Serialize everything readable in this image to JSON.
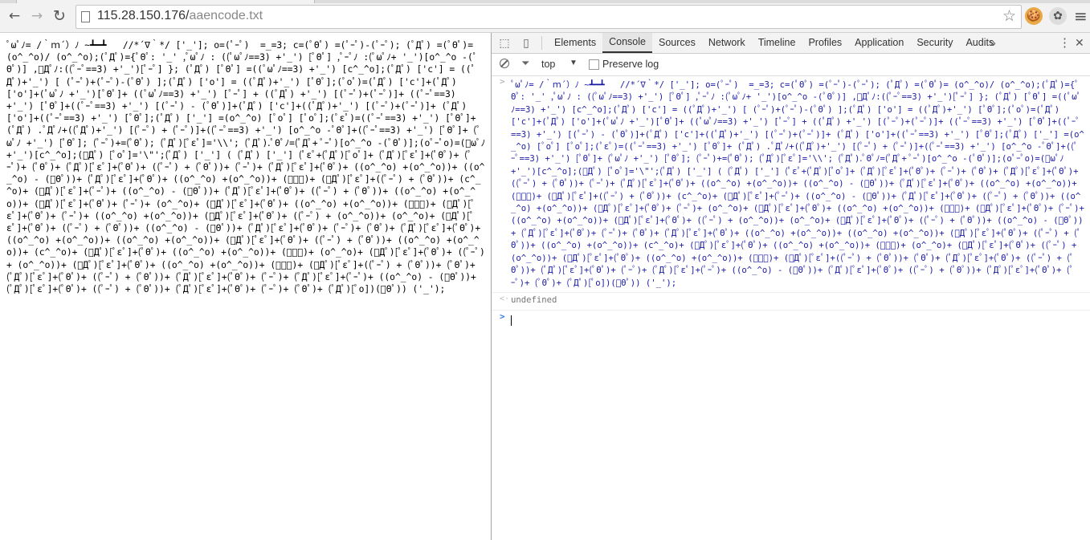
{
  "browser": {
    "url_host": "115.28.150.176/",
    "url_path": "aaencode.txt",
    "back_glyph": "←",
    "forward_glyph": "→",
    "reload_glyph": "↻",
    "star_glyph": "☆",
    "menu_glyph": "≡",
    "ext1_glyph": "🍪",
    "ext2_glyph": "✿"
  },
  "page_text": "ﾟωﾟﾉ= /｀ｍ´）ﾉ ~┻━┻   //*´∇｀*/ ['_']; o=(ﾟｰﾟ)  =_=3; c=(ﾟΘﾟ) =(ﾟｰﾟ)-(ﾟｰﾟ); (ﾟДﾟ) =(ﾟΘﾟ)= (o^_^o)/ (o^_^o);(ﾟДﾟ)={ﾟΘﾟ: '_' ,ﾟωﾟﾉ : ((ﾟωﾟﾉ==3) +'_') [ﾟΘﾟ] ,ﾟｰﾟﾉ :(ﾟωﾟﾉ+ '_')[o^_^o -(ﾟΘﾟ)] ,ﾟДﾟﾉ:((ﾟｰﾟ==3) +'_')[ﾟｰﾟ] }; (ﾟДﾟ) [ﾟΘﾟ] =((ﾟωﾟﾉ==3) +'_') [c^_^o];(ﾟДﾟ) ['c'] = ((ﾟДﾟ)+'_') [ (ﾟｰﾟ)+(ﾟｰﾟ)-(ﾟΘﾟ) ];(ﾟДﾟ) ['o'] = ((ﾟДﾟ)+'_') [ﾟΘﾟ];(ﾟoﾟ)=(ﾟДﾟ) ['c']+(ﾟДﾟ) ['o']+(ﾟωﾟﾉ +'_')[ﾟΘﾟ]+ ((ﾟωﾟﾉ==3) +'_') [ﾟｰﾟ] + ((ﾟДﾟ) +'_') [(ﾟｰﾟ)+(ﾟｰﾟ)]+ ((ﾟｰﾟ==3) +'_') [ﾟΘﾟ]+((ﾟｰﾟ==3) +'_') [(ﾟｰﾟ) - (ﾟΘﾟ)]+(ﾟДﾟ) ['c']+((ﾟДﾟ)+'_') [(ﾟｰﾟ)+(ﾟｰﾟ)]+ (ﾟДﾟ) ['o']+((ﾟｰﾟ==3) +'_') [ﾟΘﾟ];(ﾟДﾟ) ['_'] =(o^_^o) [ﾟoﾟ] [ﾟoﾟ];(ﾟεﾟ)=((ﾟｰﾟ==3) +'_') [ﾟΘﾟ]+ (ﾟДﾟ) .ﾟДﾟﾉ+((ﾟДﾟ)+'_') [(ﾟｰﾟ) + (ﾟｰﾟ)]+((ﾟｰﾟ==3) +'_') [o^_^o -ﾟΘﾟ]+((ﾟｰﾟ==3) +'_') [ﾟΘﾟ]+ (ﾟωﾟﾉ +'_') [ﾟΘﾟ]; (ﾟｰﾟ)+=(ﾟΘﾟ); (ﾟДﾟ)[ﾟεﾟ]='\\\\'; (ﾟДﾟ).ﾟΘﾟﾉ=(ﾟДﾟ+ ﾟｰﾟ)[o^_^o -(ﾟΘﾟ)];(oﾟｰﾟo)=(ﾟωﾟﾉ +'_')[c^_^o];(ﾟДﾟ) [ﾟoﾟ]='\\\"';(ﾟДﾟ) ['_'] ( (ﾟДﾟ) ['_'] (ﾟεﾟ+(ﾟДﾟ)[ﾟoﾟ]+ (ﾟДﾟ)[ﾟεﾟ]+(ﾟΘﾟ)+ (ﾟｰﾟ)+ (ﾟΘﾟ)+ (ﾟДﾟ)[ﾟεﾟ]+(ﾟΘﾟ)+ ((ﾟｰﾟ) + (ﾟΘﾟ))+ (ﾟｰﾟ)+ (ﾟДﾟ)[ﾟεﾟ]+(ﾟΘﾟ)+ ((o^_^o) +(o^_^o))+ ((o^_^o) - (ﾟΘﾟ))+ (ﾟДﾟ)[ﾟεﾟ]+(ﾟΘﾟ)+ ((o^_^o) +(o^_^o))+ (ﾟｰﾟ)+ (ﾟДﾟ)[ﾟεﾟ]+((ﾟｰﾟ) + (ﾟΘﾟ))+ (c^_^o)+ (ﾟДﾟ)[ﾟεﾟ]+(ﾟｰﾟ)+ ((o^_^o) - (ﾟΘﾟ))+ (ﾟДﾟ)[ﾟεﾟ]+(ﾟΘﾟ)+ ((ﾟｰﾟ) + (ﾟΘﾟ))+ ((o^_^o) +(o^_^o))+ (ﾟДﾟ)[ﾟεﾟ]+(ﾟΘﾟ)+ (ﾟｰﾟ)+ (o^_^o)+ (ﾟДﾟ)[ﾟεﾟ]+(ﾟΘﾟ)+ ((o^_^o) +(o^_^o))+ (ﾟｰﾟ)+ (ﾟДﾟ)[ﾟεﾟ]+(ﾟΘﾟ)+ (ﾟｰﾟ)+ ((o^_^o) +(o^_^o))+ (ﾟДﾟ)[ﾟεﾟ]+(ﾟΘﾟ)+ ((ﾟｰﾟ) + (o^_^o))+ (o^_^o)+ (ﾟДﾟ)[ﾟεﾟ]+(ﾟΘﾟ)+ ((ﾟｰﾟ) + (ﾟΘﾟ))+ ((o^_^o) - (ﾟΘﾟ))+ (ﾟДﾟ)[ﾟεﾟ]+(ﾟΘﾟ)+ (ﾟｰﾟ)+ (ﾟΘﾟ)+ (ﾟДﾟ)[ﾟεﾟ]+(ﾟΘﾟ)+ ((o^_^o) +(o^_^o))+ ((o^_^o) +(o^_^o))+ (ﾟДﾟ)[ﾟεﾟ]+(ﾟΘﾟ)+ ((ﾟｰﾟ) + (ﾟΘﾟ))+ ((o^_^o) +(o^_^o))+ (c^_^o)+ (ﾟДﾟ)[ﾟεﾟ]+(ﾟΘﾟ)+ ((o^_^o) +(o^_^o))+ (ﾟｰﾟ)+ (o^_^o)+ (ﾟДﾟ)[ﾟεﾟ]+(ﾟΘﾟ)+ ((ﾟｰﾟ) + (o^_^o))+ (ﾟДﾟ)[ﾟεﾟ]+(ﾟΘﾟ)+ ((o^_^o) +(o^_^o))+ (ﾟｰﾟ)+ (ﾟДﾟ)[ﾟεﾟ]+((ﾟｰﾟ) + (ﾟΘﾟ))+ (ﾟΘﾟ)+ (ﾟДﾟ)[ﾟεﾟ]+(ﾟΘﾟ)+ ((ﾟｰﾟ) + (ﾟΘﾟ))+ (ﾟДﾟ)[ﾟεﾟ]+(ﾟΘﾟ)+ (ﾟｰﾟ)+ (ﾟДﾟ)[ﾟεﾟ]+(ﾟｰﾟ)+ ((o^_^o) - (ﾟΘﾟ))+ (ﾟДﾟ)[ﾟεﾟ]+(ﾟΘﾟ)+ ((ﾟｰﾟ) + (ﾟΘﾟ))+ (ﾟДﾟ)[ﾟεﾟ]+(ﾟΘﾟ)+ (ﾟｰﾟ)+ (ﾟΘﾟ)+ (ﾟДﾟ)[ﾟo])(ﾟΘﾟ)) ('_');",
  "devtools": {
    "tabs": [
      "Elements",
      "Console",
      "Sources",
      "Network",
      "Timeline",
      "Profiles",
      "Application",
      "Security",
      "Audits"
    ],
    "more_glyph": "»",
    "kebab_glyph": "⋮",
    "close_glyph": "✕",
    "inspect_glyph": "⬚",
    "device_glyph": "▯",
    "console": {
      "context": "top",
      "dropdown_glyph": "▼",
      "filter_glyph": "⏷",
      "preserve_log": "Preserve log",
      "input_marker": ">",
      "result_marker": "<·",
      "prompt_marker": ">",
      "input_text": "ﾟωﾟﾉ= /｀ｍ´）ﾉ ~┻━┻   //*´∇｀*/ ['_']; o=(ﾟｰﾟ)  =_=3; c=(ﾟΘﾟ) =(ﾟｰﾟ)-(ﾟｰﾟ); (ﾟДﾟ) =(ﾟΘﾟ)= (o^_^o)/ (o^_^o);(ﾟДﾟ)={ﾟΘﾟ: '_' ,ﾟωﾟﾉ : ((ﾟωﾟﾉ==3) +'_') [ﾟΘﾟ] ,ﾟｰﾟﾉ :(ﾟωﾟﾉ+ '_')[o^_^o -(ﾟΘﾟ)] ,ﾟДﾟﾉ:((ﾟｰﾟ==3) +'_')[ﾟｰﾟ] }; (ﾟДﾟ) [ﾟΘﾟ] =((ﾟωﾟﾉ==3) +'_') [c^_^o];(ﾟДﾟ) ['c'] = ((ﾟДﾟ)+'_') [ (ﾟｰﾟ)+(ﾟｰﾟ)-(ﾟΘﾟ) ];(ﾟДﾟ) ['o'] = ((ﾟДﾟ)+'_') [ﾟΘﾟ];(ﾟoﾟ)=(ﾟДﾟ) ['c']+(ﾟДﾟ) ['o']+(ﾟωﾟﾉ +'_')[ﾟΘﾟ]+ ((ﾟωﾟﾉ==3) +'_') [ﾟｰﾟ] + ((ﾟДﾟ) +'_') [(ﾟｰﾟ)+(ﾟｰﾟ)]+ ((ﾟｰﾟ==3) +'_') [ﾟΘﾟ]+((ﾟｰﾟ==3) +'_') [(ﾟｰﾟ) - (ﾟΘﾟ)]+(ﾟДﾟ) ['c']+((ﾟДﾟ)+'_') [(ﾟｰﾟ)+(ﾟｰﾟ)]+ (ﾟДﾟ) ['o']+((ﾟｰﾟ==3) +'_') [ﾟΘﾟ];(ﾟДﾟ) ['_'] =(o^_^o) [ﾟoﾟ] [ﾟoﾟ];(ﾟεﾟ)=((ﾟｰﾟ==3) +'_') [ﾟΘﾟ]+ (ﾟДﾟ) .ﾟДﾟﾉ+((ﾟДﾟ)+'_') [(ﾟｰﾟ) + (ﾟｰﾟ)]+((ﾟｰﾟ==3) +'_') [o^_^o -ﾟΘﾟ]+((ﾟｰﾟ==3) +'_') [ﾟΘﾟ]+ (ﾟωﾟﾉ +'_') [ﾟΘﾟ]; (ﾟｰﾟ)+=(ﾟΘﾟ); (ﾟДﾟ)[ﾟεﾟ]='\\\\'; (ﾟДﾟ).ﾟΘﾟﾉ=(ﾟДﾟ+ ﾟｰﾟ)[o^_^o -(ﾟΘﾟ)];(oﾟｰﾟo)=(ﾟωﾟﾉ +'_')[c^_^o];(ﾟДﾟ) [ﾟoﾟ]='\\\"';(ﾟДﾟ) ['_'] ( (ﾟДﾟ) ['_'] (ﾟεﾟ+(ﾟДﾟ)[ﾟoﾟ]+ (ﾟДﾟ)[ﾟεﾟ]+(ﾟΘﾟ)+ (ﾟｰﾟ)+ (ﾟΘﾟ)+ (ﾟДﾟ)[ﾟεﾟ]+(ﾟΘﾟ)+ ((ﾟｰﾟ) + (ﾟΘﾟ))+ (ﾟｰﾟ)+ (ﾟДﾟ)[ﾟεﾟ]+(ﾟΘﾟ)+ ((o^_^o) +(o^_^o))+ ((o^_^o) - (ﾟΘﾟ))+ (ﾟДﾟ)[ﾟεﾟ]+(ﾟΘﾟ)+ ((o^_^o) +(o^_^o))+ (ﾟｰﾟ)+ (ﾟДﾟ)[ﾟεﾟ]+((ﾟｰﾟ) + (ﾟΘﾟ))+ (c^_^o)+ (ﾟДﾟ)[ﾟεﾟ]+(ﾟｰﾟ)+ ((o^_^o) - (ﾟΘﾟ))+ (ﾟДﾟ)[ﾟεﾟ]+(ﾟΘﾟ)+ ((ﾟｰﾟ) + (ﾟΘﾟ))+ ((o^_^o) +(o^_^o))+ (ﾟДﾟ)[ﾟεﾟ]+(ﾟΘﾟ)+ (ﾟｰﾟ)+ (o^_^o)+ (ﾟДﾟ)[ﾟεﾟ]+(ﾟΘﾟ)+ ((o^_^o) +(o^_^o))+ (ﾟｰﾟ)+ (ﾟДﾟ)[ﾟεﾟ]+(ﾟΘﾟ)+ (ﾟｰﾟ)+ ((o^_^o) +(o^_^o))+ (ﾟДﾟ)[ﾟεﾟ]+(ﾟΘﾟ)+ ((ﾟｰﾟ) + (o^_^o))+ (o^_^o)+ (ﾟДﾟ)[ﾟεﾟ]+(ﾟΘﾟ)+ ((ﾟｰﾟ) + (ﾟΘﾟ))+ ((o^_^o) - (ﾟΘﾟ))+ (ﾟДﾟ)[ﾟεﾟ]+(ﾟΘﾟ)+ (ﾟｰﾟ)+ (ﾟΘﾟ)+ (ﾟДﾟ)[ﾟεﾟ]+(ﾟΘﾟ)+ ((o^_^o) +(o^_^o))+ ((o^_^o) +(o^_^o))+ (ﾟДﾟ)[ﾟεﾟ]+(ﾟΘﾟ)+ ((ﾟｰﾟ) + (ﾟΘﾟ))+ ((o^_^o) +(o^_^o))+ (c^_^o)+ (ﾟДﾟ)[ﾟεﾟ]+(ﾟΘﾟ)+ ((o^_^o) +(o^_^o))+ (ﾟｰﾟ)+ (o^_^o)+ (ﾟДﾟ)[ﾟεﾟ]+(ﾟΘﾟ)+ ((ﾟｰﾟ) + (o^_^o))+ (ﾟДﾟ)[ﾟεﾟ]+(ﾟΘﾟ)+ ((o^_^o) +(o^_^o))+ (ﾟｰﾟ)+ (ﾟДﾟ)[ﾟεﾟ]+((ﾟｰﾟ) + (ﾟΘﾟ))+ (ﾟΘﾟ)+ (ﾟДﾟ)[ﾟεﾟ]+(ﾟΘﾟ)+ ((ﾟｰﾟ) + (ﾟΘﾟ))+ (ﾟДﾟ)[ﾟεﾟ]+(ﾟΘﾟ)+ (ﾟｰﾟ)+ (ﾟДﾟ)[ﾟεﾟ]+(ﾟｰﾟ)+ ((o^_^o) - (ﾟΘﾟ))+ (ﾟДﾟ)[ﾟεﾟ]+(ﾟΘﾟ)+ ((ﾟｰﾟ) + (ﾟΘﾟ))+ (ﾟДﾟ)[ﾟεﾟ]+(ﾟΘﾟ)+ (ﾟｰﾟ)+ (ﾟΘﾟ)+ (ﾟДﾟ)[ﾟo])(ﾟΘﾟ)) ('_');",
      "result_text": "undefined"
    }
  }
}
